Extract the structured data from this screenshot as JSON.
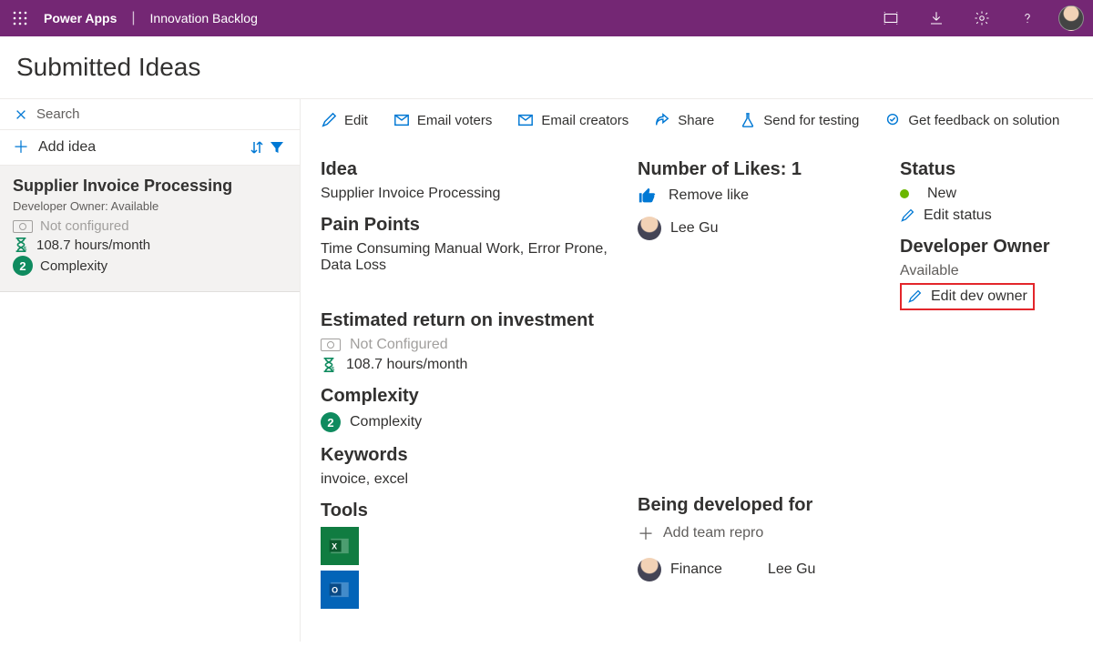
{
  "topbar": {
    "app": "Power Apps",
    "sub": "Innovation Backlog"
  },
  "page": {
    "title": "Submitted Ideas"
  },
  "search": {
    "placeholder": "Search"
  },
  "add": {
    "label": "Add idea"
  },
  "idea_card": {
    "title": "Supplier Invoice Processing",
    "owner": "Developer Owner: Available",
    "cost": "Not configured",
    "hours": "108.7 hours/month",
    "complexity_badge": "2",
    "complexity_label": "Complexity"
  },
  "actions": {
    "edit": "Edit",
    "email_voters": "Email voters",
    "email_creators": "Email creators",
    "share": "Share",
    "send_testing": "Send for testing",
    "get_feedback": "Get feedback on solution"
  },
  "detail": {
    "idea_h": "Idea",
    "idea_v": "Supplier Invoice Processing",
    "pain_h": "Pain Points",
    "pain_v": "Time Consuming Manual Work, Error Prone, Data Loss",
    "roi_h": "Estimated return on investment",
    "roi_cost": "Not Configured",
    "roi_hours": "108.7 hours/month",
    "complexity_h": "Complexity",
    "complexity_badge": "2",
    "complexity_label": "Complexity",
    "keywords_h": "Keywords",
    "keywords_v": "invoice, excel",
    "tools_h": "Tools"
  },
  "likes": {
    "header": "Number of Likes: 1",
    "remove": "Remove like",
    "voter": "Lee Gu"
  },
  "dev_for": {
    "header": "Being developed for",
    "add": "Add team repro",
    "team": "Finance",
    "person": "Lee Gu"
  },
  "status": {
    "header": "Status",
    "value": "New",
    "edit": "Edit status",
    "owner_h": "Developer Owner",
    "owner_v": "Available",
    "edit_owner": "Edit dev owner"
  }
}
